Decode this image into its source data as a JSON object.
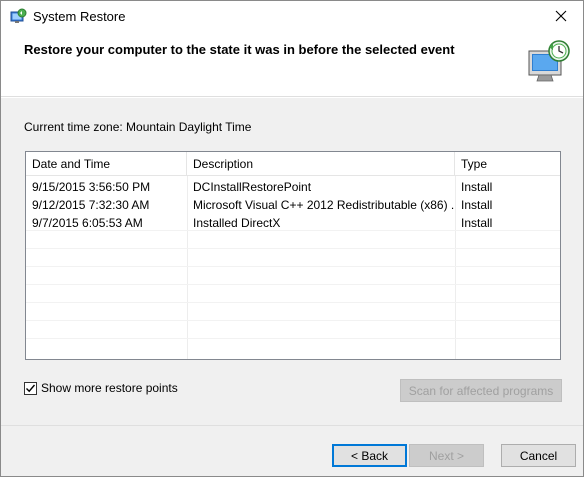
{
  "window": {
    "title": "System Restore",
    "icon": "system-restore-icon"
  },
  "header": {
    "heading": "Restore your computer to the state it was in before the selected event",
    "graphic": "restore-computer-graphic"
  },
  "body": {
    "timezone_label": "Current time zone: Mountain Daylight Time",
    "list": {
      "columns": [
        "Date and Time",
        "Description",
        "Type"
      ],
      "sorted_column": "Date and Time",
      "rows": [
        {
          "date": "9/15/2015 3:56:50 PM",
          "description": "DCInstallRestorePoint",
          "type": "Install"
        },
        {
          "date": "9/12/2015 7:32:30 AM",
          "description": "Microsoft Visual C++ 2012 Redistributable (x86) ...",
          "type": "Install"
        },
        {
          "date": "9/7/2015 6:05:53 AM",
          "description": "Installed DirectX",
          "type": "Install"
        }
      ]
    },
    "show_more_label": "Show more restore points",
    "show_more_checked": true,
    "scan_button": "Scan for affected programs"
  },
  "footer": {
    "back_button": "< Back",
    "next_button": "Next >",
    "cancel_button": "Cancel"
  },
  "colors": {
    "accent": "#0078d7",
    "dialog_bg": "#f0f0f0"
  }
}
